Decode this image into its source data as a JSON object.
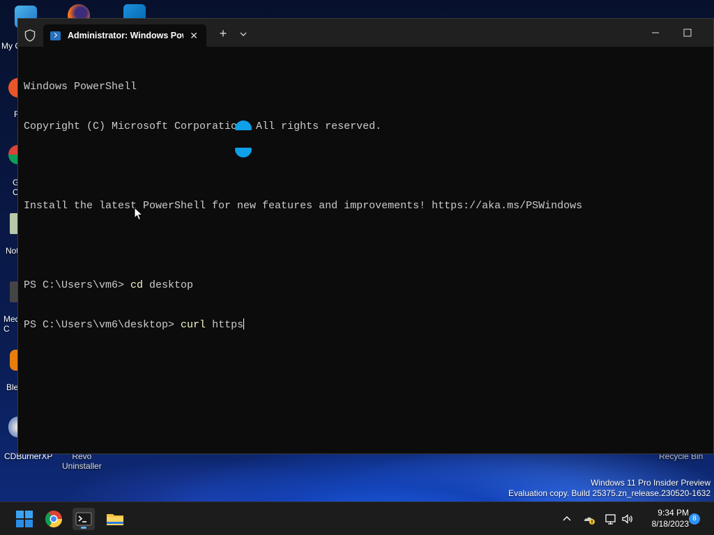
{
  "desktop": {
    "icon_labels": [
      {
        "name": "my-computer",
        "text": "My C"
      },
      {
        "name": "firefox",
        "text": "F"
      },
      {
        "name": "google-chrome",
        "text": "G\nC"
      },
      {
        "name": "notepad",
        "text": "Not"
      },
      {
        "name": "media",
        "text": "Med\nC"
      },
      {
        "name": "blender",
        "text": "Ble"
      },
      {
        "name": "cdburnerxp",
        "text": "CDBurnerXP"
      },
      {
        "name": "revo-uninstaller",
        "text": "Revo\nUninstaller"
      },
      {
        "name": "recycle-bin",
        "text": "Recycle Bin"
      }
    ],
    "watermark_line1": "Windows 11 Pro Insider Preview",
    "watermark_line2": "Evaluation copy. Build 25375.zn_release.230520-1632"
  },
  "terminal": {
    "tab_title": "Administrator: Windows PowerShell",
    "new_tab_label": "+",
    "close_tab_label": "✕",
    "lines": [
      "Windows PowerShell",
      "Copyright (C) Microsoft Corporation. All rights reserved.",
      "",
      "Install the latest PowerShell for new features and improvements! https://aka.ms/PSWindows",
      ""
    ],
    "prompt1": "PS C:\\Users\\vm6> ",
    "prompt1_cmd": "cd",
    "prompt1_arg": " desktop",
    "prompt2": "PS C:\\Users\\vm6\\desktop> ",
    "prompt2_cmd": "curl",
    "prompt2_arg": " https"
  },
  "taskbar": {
    "time": "9:34 PM",
    "date": "8/18/2023",
    "notification_count": "8"
  },
  "colors": {
    "console_bg": "#0c0c0c",
    "console_text": "#cccccc",
    "command_text": "#f2f2c8",
    "selection_handle": "#0ea0e8",
    "taskbar_bg": "#1c1c1c",
    "accent": "#2f93f5"
  }
}
